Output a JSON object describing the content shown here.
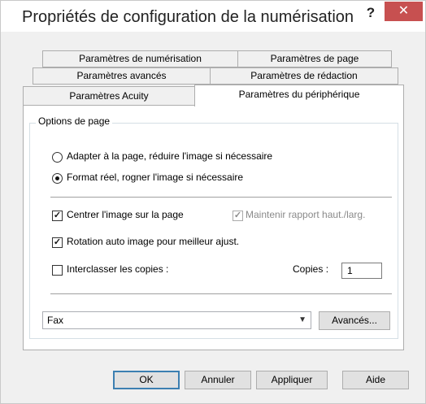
{
  "window": {
    "title": "Propriétés de configuration de la numérisation",
    "help": "?",
    "close": "✕"
  },
  "tabs": {
    "row1": [
      "Paramètres de numérisation",
      "Paramètres de page"
    ],
    "row2": [
      "Paramètres avancés",
      "Paramètres de rédaction"
    ],
    "row3": [
      "Paramètres Acuity",
      "Paramètres du périphérique"
    ],
    "active": "Paramètres du périphérique"
  },
  "page_options": {
    "legend": "Options de page",
    "fit_label": "Adapter à la page, réduire l'image si nécessaire",
    "fit_selected": false,
    "actual_label": "Format réel, rogner l'image si nécessaire",
    "actual_selected": true,
    "center_label": "Centrer l'image sur la page",
    "center_checked": true,
    "aspect_label": "Maintenir rapport haut./larg.",
    "aspect_checked": true,
    "aspect_disabled": true,
    "rotate_label": "Rotation auto image pour meilleur ajust.",
    "rotate_checked": true,
    "collate_label": "Interclasser les copies :",
    "collate_checked": false,
    "copies_label": "Copies :",
    "copies_value": "1",
    "device_value": "Fax",
    "advanced_button": "Avancés..."
  },
  "buttons": {
    "ok": "OK",
    "cancel": "Annuler",
    "apply": "Appliquer",
    "help": "Aide"
  }
}
